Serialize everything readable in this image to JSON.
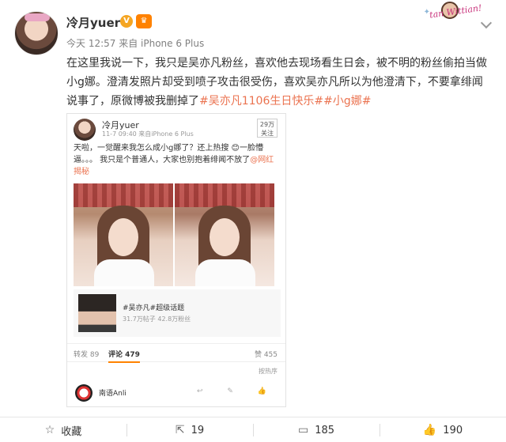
{
  "header": {
    "username": "冷月yuer",
    "vip_mark": "V",
    "meta": "今天 12:57 来自 iPhone 6 Plus"
  },
  "sticker": {
    "text": "tan Wittian!"
  },
  "post": {
    "text_main": "在这里我说一下，我只是吴亦凡粉丝，喜欢他去现场看生日会，被不明的粉丝偷拍当做小g娜。澄清发照片却受到喷子攻击很受伤，喜欢吴亦凡所以为他澄清下，不要拿绯闻说事了，原微博被我删掉了",
    "hashtag_1": "#吴亦凡1106生日快乐#",
    "hashtag_2": "#小g娜#"
  },
  "repost": {
    "username": "冷月yuer",
    "meta": "11-7 09:40 来自iPhone 6 Plus",
    "follow": "29万\n关注",
    "text": "天啦，一觉醒来我怎么成小g娜了？还上热搜 😊一脸懵逼。。。 我只是个普通人，大家也别抱着绯闻不放了",
    "mention": "@网红揭秘",
    "topic_title": "#吴亦凡#超级话题",
    "topic_stats": "31.7万帖子  42.8万粉丝",
    "repost_label": "转发 89",
    "comment_label": "评论 479",
    "like_label": "赞 455",
    "sort_label": "按热序",
    "comment_user": "南语Anli",
    "comment_icons": "↩ ✎ 👍"
  },
  "actions": {
    "favorite_label": "收藏",
    "repost_count": "19",
    "comment_count": "185",
    "like_count": "190"
  }
}
